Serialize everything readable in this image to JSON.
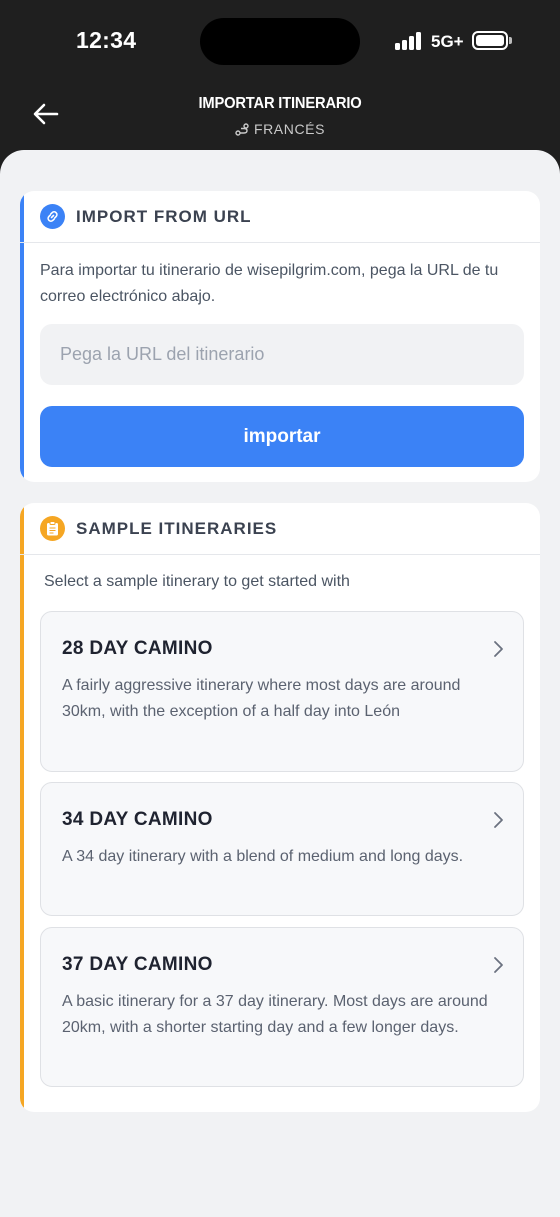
{
  "status_bar": {
    "time": "12:34",
    "network": "5G+",
    "icons": [
      "signal-icon",
      "battery-icon"
    ]
  },
  "header": {
    "title": "IMPORTAR ITINERARIO",
    "subtitle": "FRANCÉS",
    "back_icon": "arrow-left-icon",
    "route_icon": "route-icon"
  },
  "import_card": {
    "title": "IMPORT FROM URL",
    "icon": "link-icon",
    "description": "Para importar tu itinerario de wisepilgrim.com, pega la URL de tu correo electrónico abajo.",
    "input_placeholder": "Pega la URL del itinerario",
    "input_value": "",
    "button_label": "importar"
  },
  "samples_card": {
    "title": "SAMPLE ITINERARIES",
    "icon": "clipboard-icon",
    "intro": "Select a sample itinerary to get started with",
    "items": [
      {
        "title": "28 DAY CAMINO",
        "description": "A fairly aggressive itinerary where most days are around 30km, with the exception of a half day into León"
      },
      {
        "title": "34 DAY CAMINO",
        "description": "A 34 day itinerary with a blend of medium and long days."
      },
      {
        "title": "37 DAY CAMINO",
        "description": "A basic itinerary for a 37 day itinerary. Most days are around 20km, with a shorter starting day and a few longer days."
      }
    ]
  },
  "colors": {
    "primary_blue": "#3b82f6",
    "accent_orange": "#f5a623",
    "header_bg": "#1f1f1f",
    "sheet_bg": "#f1f2f4"
  }
}
